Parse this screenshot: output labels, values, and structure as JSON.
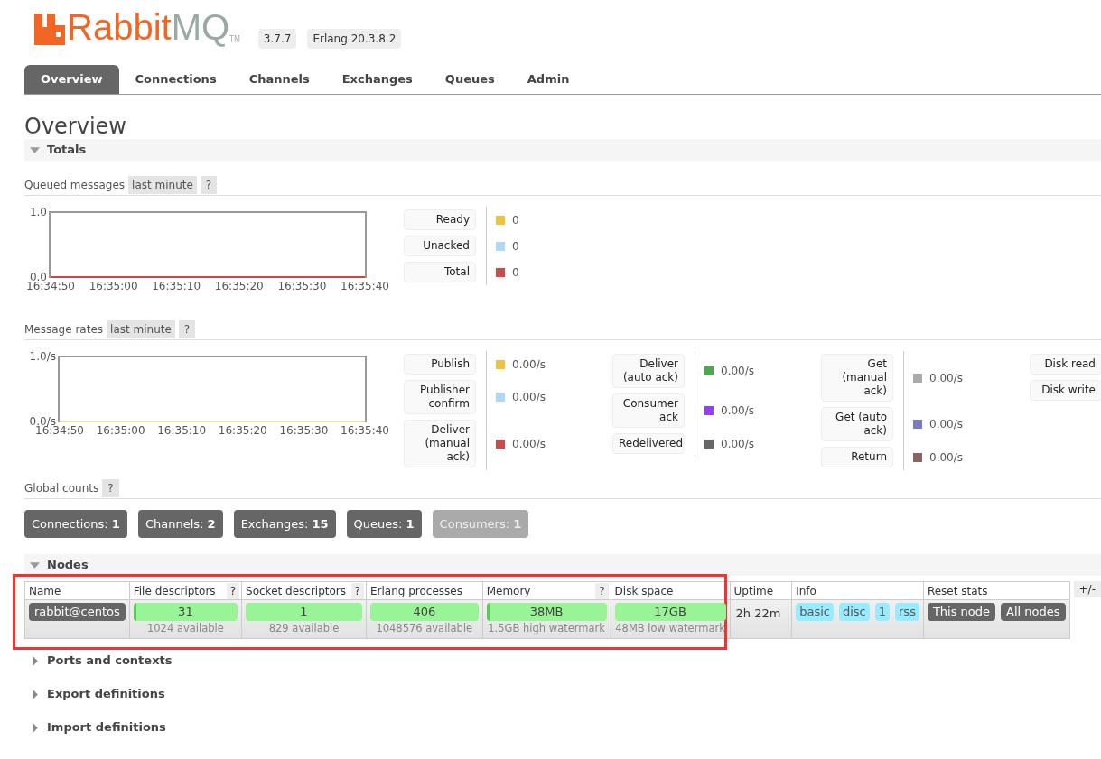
{
  "header": {
    "logo_left": "Rabbit",
    "logo_right": "MQ",
    "trademark": "TM",
    "version": "3.7.7",
    "erlang": "Erlang 20.3.8.2"
  },
  "tabs": [
    {
      "label": "Overview",
      "selected": true
    },
    {
      "label": "Connections",
      "selected": false
    },
    {
      "label": "Channels",
      "selected": false
    },
    {
      "label": "Exchanges",
      "selected": false
    },
    {
      "label": "Queues",
      "selected": false
    },
    {
      "label": "Admin",
      "selected": false
    }
  ],
  "page_title": "Overview",
  "totals": {
    "title": "Totals",
    "expanded": true,
    "queued": {
      "label": "Queued messages",
      "range": "last minute",
      "help": "?",
      "chart_data": {
        "type": "line",
        "x": [
          "16:34:50",
          "16:35:00",
          "16:35:10",
          "16:35:20",
          "16:35:30",
          "16:35:40"
        ],
        "yticks": [
          {
            "value": 0,
            "label": "0.0"
          },
          {
            "value": 1,
            "label": "1.0"
          }
        ],
        "ylim": [
          0,
          1
        ],
        "series": [
          {
            "color": "#cc4444",
            "values": [
              0,
              0,
              0,
              0,
              0,
              0
            ]
          }
        ]
      },
      "legend_groups": [
        [
          {
            "label": "Ready",
            "color": "#edc240",
            "value": "0"
          },
          {
            "label": "Unacked",
            "color": "#afd8f8",
            "value": "0"
          },
          {
            "label": "Total",
            "color": "#cb4b4b",
            "value": "0"
          }
        ]
      ]
    },
    "rates": {
      "label": "Message rates",
      "range": "last minute",
      "help": "?",
      "chart_data": {
        "type": "line",
        "x": [
          "16:34:50",
          "16:35:00",
          "16:35:10",
          "16:35:20",
          "16:35:30",
          "16:35:40"
        ],
        "yticks": [
          {
            "value": 0,
            "label": "0.0/s"
          },
          {
            "value": 1,
            "label": "1.0/s"
          }
        ],
        "ylim": [
          0,
          1
        ],
        "series": [
          {
            "color": "#e8e2a0",
            "values": [
              0,
              0,
              0,
              0,
              0,
              0
            ]
          }
        ]
      },
      "legend_groups": [
        [
          {
            "label": "Publish",
            "color": "#edc240",
            "value": "0.00/s"
          },
          {
            "label": "Publisher confirm",
            "color": "#afd8f8",
            "value": "0.00/s"
          },
          {
            "label": "Deliver (manual ack)",
            "color": "#cb4b4b",
            "value": "0.00/s"
          }
        ],
        [
          {
            "label": "Deliver (auto ack)",
            "color": "#4da74d",
            "value": "0.00/s"
          },
          {
            "label": "Consumer ack",
            "color": "#9440ed",
            "value": "0.00/s"
          },
          {
            "label": "Redelivered",
            "color": "#666666",
            "value": "0.00/s"
          }
        ],
        [
          {
            "label": "Get (manual ack)",
            "color": "#aaaaaa",
            "value": "0.00/s"
          },
          {
            "label": "Get (auto ack)",
            "color": "#7c79c3",
            "value": "0.00/s"
          },
          {
            "label": "Return",
            "color": "#8d6363",
            "value": "0.00/s"
          }
        ],
        [
          {
            "label": "Disk read"
          },
          {
            "label": "Disk write"
          }
        ]
      ]
    },
    "global": {
      "label": "Global counts",
      "help": "?",
      "counts": [
        {
          "label": "Connections:",
          "value": "1",
          "disabled": false
        },
        {
          "label": "Channels:",
          "value": "2",
          "disabled": false
        },
        {
          "label": "Exchanges:",
          "value": "15",
          "disabled": false
        },
        {
          "label": "Queues:",
          "value": "1",
          "disabled": false
        },
        {
          "label": "Consumers:",
          "value": "1",
          "disabled": true
        }
      ]
    }
  },
  "nodes": {
    "title": "Nodes",
    "expanded": true,
    "highlighted": true,
    "toggle": "+/-",
    "columns": [
      {
        "label": "Name"
      },
      {
        "label": "File descriptors",
        "help": "?"
      },
      {
        "label": "Socket descriptors",
        "help": "?"
      },
      {
        "label": "Erlang processes"
      },
      {
        "label": "Memory",
        "help": "?"
      },
      {
        "label": "Disk space"
      },
      {
        "label": "Uptime"
      },
      {
        "label": "Info"
      },
      {
        "label": "Reset stats"
      }
    ],
    "rows": [
      {
        "name": "rabbit@centos",
        "meters": [
          {
            "value": "31",
            "note": "1024 available",
            "level": 0.03
          },
          {
            "value": "1",
            "note": "829 available"
          },
          {
            "value": "406",
            "note": "1048576 available"
          },
          {
            "value": "38MB",
            "note": "1.5GB high watermark",
            "level": 0.025
          },
          {
            "value": "17GB",
            "note": "48MB low watermark"
          }
        ],
        "uptime": "2h 22m",
        "info": [
          "basic",
          "disc",
          "1",
          "rss"
        ],
        "reset": [
          "This node",
          "All nodes"
        ]
      }
    ]
  },
  "sections": [
    {
      "title": "Ports and contexts",
      "expanded": false
    },
    {
      "title": "Export definitions",
      "expanded": false
    },
    {
      "title": "Import definitions",
      "expanded": false
    }
  ]
}
